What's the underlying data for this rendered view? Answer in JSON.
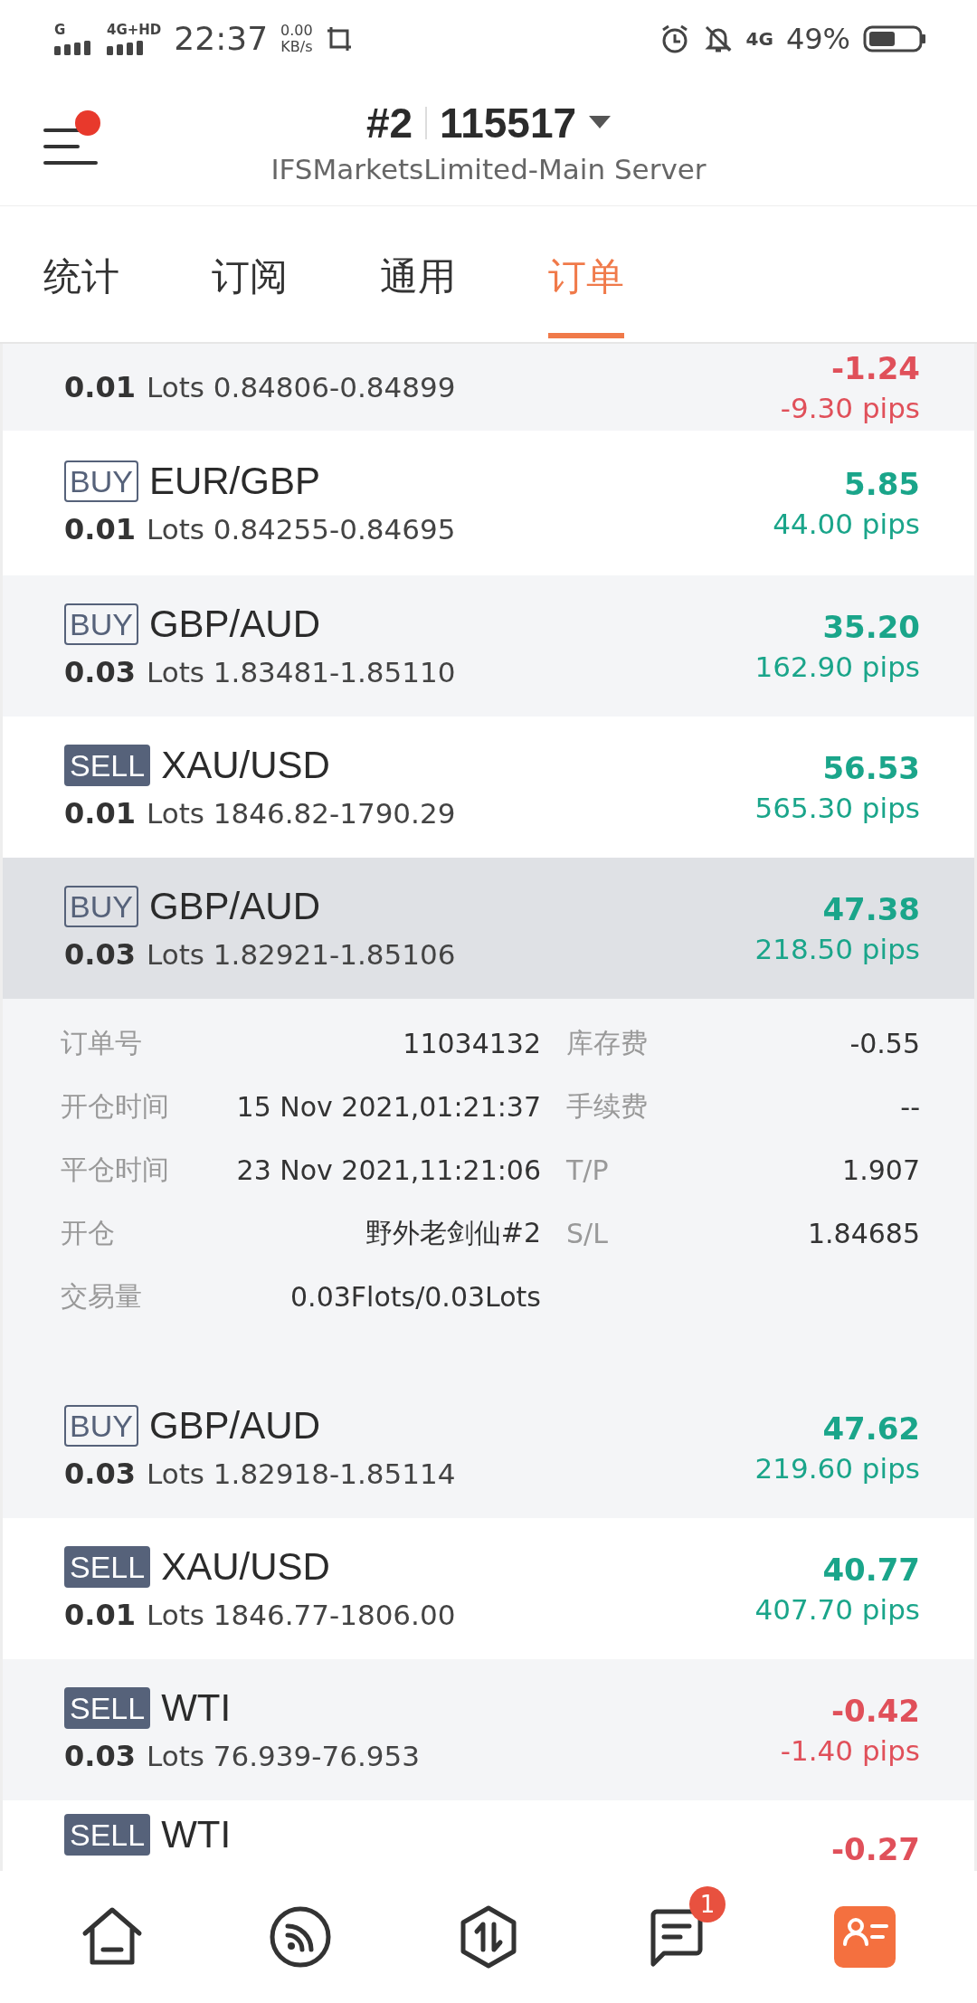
{
  "status_bar": {
    "signal_1": "G",
    "signal_2": "4G+HD",
    "time": "22:37",
    "speed": "0.00",
    "speed_unit": "KB/s",
    "network": "4G",
    "battery": "49%"
  },
  "header": {
    "account": "#2",
    "login": "115517",
    "server": "IFSMarketsLimited-Main Server",
    "notification_dot": true
  },
  "tabs": [
    {
      "label": "统计",
      "selected": false
    },
    {
      "label": "订阅",
      "selected": false
    },
    {
      "label": "通用",
      "selected": false
    },
    {
      "label": "订单",
      "selected": true
    }
  ],
  "orders": [
    {
      "kind": "partial",
      "lots": "0.01",
      "lots_unit": "Lots",
      "range": "0.84806-0.84899",
      "profit": "-1.24",
      "pips": "-9.30 pips",
      "negative": true,
      "selected": false
    },
    {
      "kind": "full",
      "side": "BUY",
      "badge_filled": false,
      "symbol": "EUR/GBP",
      "lots": "0.01",
      "lots_unit": "Lots",
      "range": "0.84255-0.84695",
      "profit": "5.85",
      "pips": "44.00 pips",
      "negative": false,
      "selected": false
    },
    {
      "kind": "full",
      "side": "BUY",
      "badge_filled": false,
      "symbol": "GBP/AUD",
      "lots": "0.03",
      "lots_unit": "Lots",
      "range": "1.83481-1.85110",
      "profit": "35.20",
      "pips": "162.90 pips",
      "negative": false,
      "selected": false
    },
    {
      "kind": "full",
      "side": "SELL",
      "badge_filled": true,
      "symbol": "XAU/USD",
      "lots": "0.01",
      "lots_unit": "Lots",
      "range": "1846.82-1790.29",
      "profit": "56.53",
      "pips": "565.30 pips",
      "negative": false,
      "selected": false
    },
    {
      "kind": "full",
      "side": "BUY",
      "badge_filled": false,
      "symbol": "GBP/AUD",
      "lots": "0.03",
      "lots_unit": "Lots",
      "range": "1.82921-1.85106",
      "profit": "47.38",
      "pips": "218.50 pips",
      "negative": false,
      "selected": true
    },
    {
      "kind": "details",
      "rows": [
        {
          "label": "订单号",
          "value": "11034132",
          "label_2": "库存费",
          "value_2": "-0.55"
        },
        {
          "label": "开仓时间",
          "value": "15 Nov 2021,01:21:37",
          "label_2": "手续费",
          "value_2": "--"
        },
        {
          "label": "平仓时间",
          "value": "23 Nov 2021,11:21:06",
          "label_2": "T/P",
          "value_2": "1.907"
        },
        {
          "label": "开仓",
          "value": "野外老剑仙#2",
          "label_2": "S/L",
          "value_2": "1.84685"
        },
        {
          "label": "交易量",
          "value": "0.03Flots/0.03Lots"
        }
      ]
    },
    {
      "kind": "full",
      "side": "BUY",
      "badge_filled": false,
      "symbol": "GBP/AUD",
      "lots": "0.03",
      "lots_unit": "Lots",
      "range": "1.82918-1.85114",
      "profit": "47.62",
      "pips": "219.60 pips",
      "negative": false,
      "selected": false
    },
    {
      "kind": "full",
      "side": "SELL",
      "badge_filled": true,
      "symbol": "XAU/USD",
      "lots": "0.01",
      "lots_unit": "Lots",
      "range": "1846.77-1806.00",
      "profit": "40.77",
      "pips": "407.70 pips",
      "negative": false,
      "selected": false
    },
    {
      "kind": "full",
      "side": "SELL",
      "badge_filled": true,
      "symbol": "WTI",
      "lots": "0.03",
      "lots_unit": "Lots",
      "range": "76.939-76.953",
      "profit": "-0.42",
      "pips": "-1.40 pips",
      "negative": true,
      "selected": false
    },
    {
      "kind": "top",
      "side": "SELL",
      "badge_filled": true,
      "symbol": "WTI",
      "profit": "-0.27",
      "negative": true,
      "selected": false
    }
  ],
  "bottom_nav": {
    "messages_badge": "1"
  }
}
